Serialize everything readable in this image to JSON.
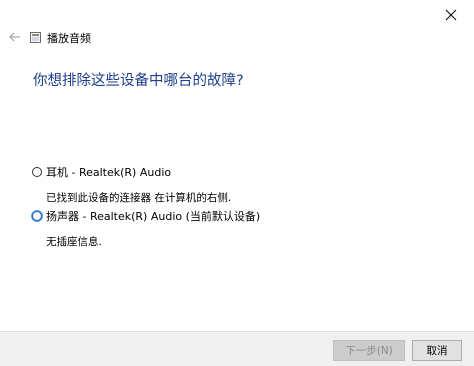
{
  "window": {
    "title": "播放音频",
    "close_label": "✕"
  },
  "main": {
    "heading": "你想排除这些设备中哪台的故障?",
    "options": [
      {
        "label": "耳机 - Realtek(R) Audio",
        "description": "已找到此设备的连接器 在计算机的右侧.",
        "selected": false
      },
      {
        "label": "扬声器 - Realtek(R) Audio (当前默认设备)",
        "description": "无插座信息.",
        "selected": false
      }
    ]
  },
  "footer": {
    "next_label": "下一步(N)",
    "cancel_label": "取消"
  },
  "colors": {
    "heading": "#1e3f8c",
    "footer_bg": "#f0f0f0",
    "focus": "#1a5fb4"
  },
  "icons": {
    "back": "arrow-left-icon",
    "app": "audio-troubleshooter-icon",
    "close": "close-icon"
  }
}
